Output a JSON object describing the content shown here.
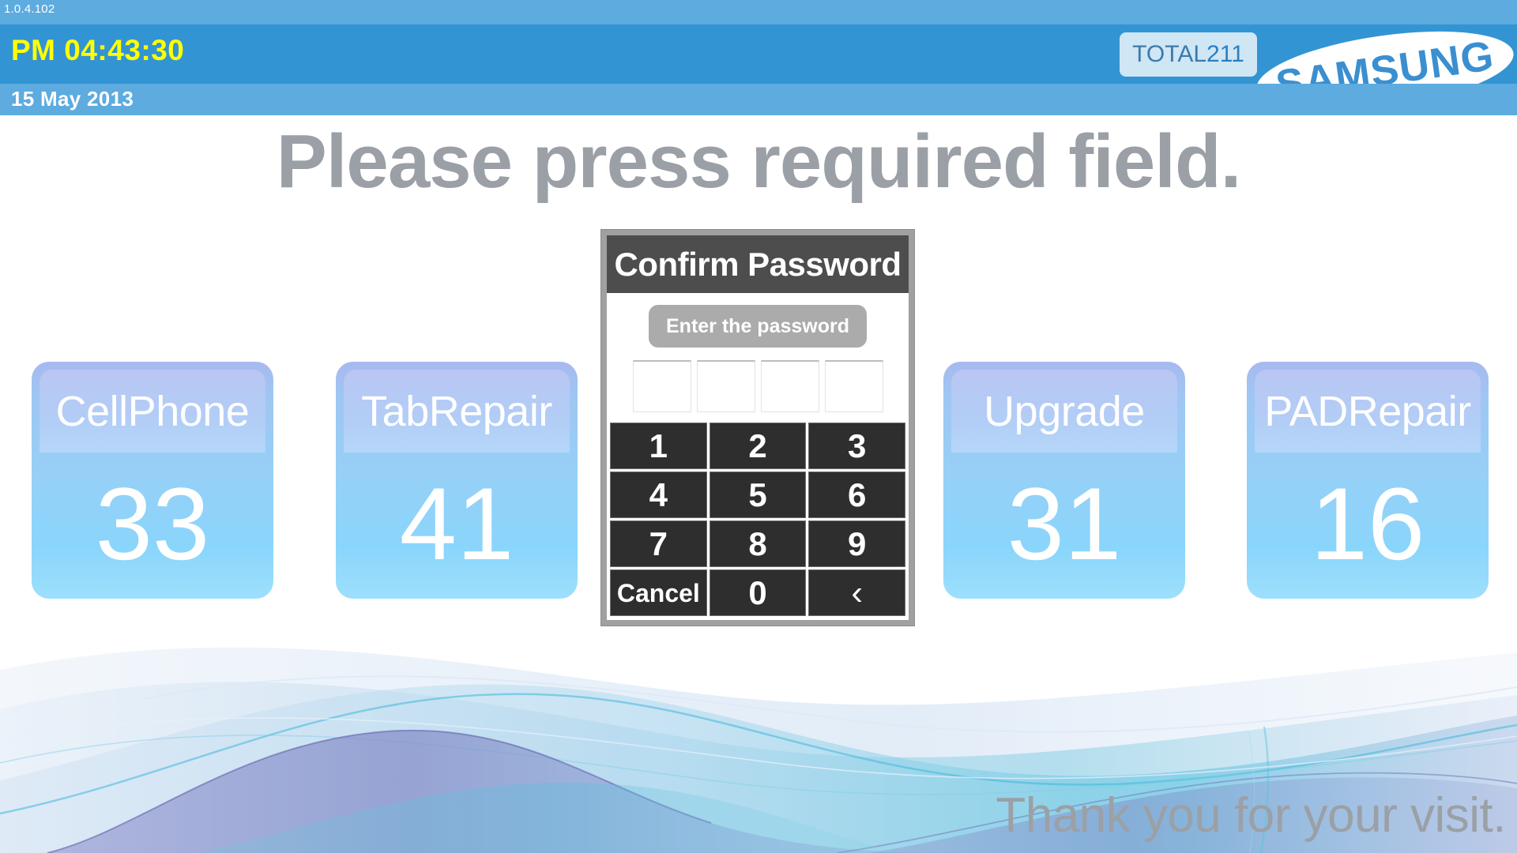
{
  "header": {
    "version": "1.0.4.102",
    "clock": "PM 04:43:30",
    "date": "15 May 2013",
    "total_label": "TOTAL",
    "total_value": "211",
    "brand": "SAMSUNG",
    "colors": {
      "band_light": "#5dabdf",
      "band_main": "#3394d3",
      "clock_text": "#ffff00",
      "badge_bg": "#cfe6f5",
      "badge_text": "#2a7fc4"
    }
  },
  "main": {
    "title": "Please press required field.",
    "title_color": "#9ba0a6",
    "tiles": [
      {
        "label": "CellPhone",
        "count": "33"
      },
      {
        "label": "TabRepair",
        "count": "41"
      },
      {
        "label": "Upgrade",
        "count": "31"
      },
      {
        "label": "PADRepair",
        "count": "16"
      }
    ]
  },
  "dialog": {
    "title": "Confirm Password",
    "hint": "Enter the password",
    "password_digits": [
      "",
      "",
      "",
      ""
    ],
    "keys": [
      {
        "label": "1",
        "name": "key-1",
        "kind": "digit"
      },
      {
        "label": "2",
        "name": "key-2",
        "kind": "digit"
      },
      {
        "label": "3",
        "name": "key-3",
        "kind": "digit"
      },
      {
        "label": "4",
        "name": "key-4",
        "kind": "digit"
      },
      {
        "label": "5",
        "name": "key-5",
        "kind": "digit"
      },
      {
        "label": "6",
        "name": "key-6",
        "kind": "digit"
      },
      {
        "label": "7",
        "name": "key-7",
        "kind": "digit"
      },
      {
        "label": "8",
        "name": "key-8",
        "kind": "digit"
      },
      {
        "label": "9",
        "name": "key-9",
        "kind": "digit"
      },
      {
        "label": "Cancel",
        "name": "key-cancel",
        "kind": "cancel"
      },
      {
        "label": "0",
        "name": "key-0",
        "kind": "digit"
      },
      {
        "label": "‹",
        "name": "key-backspace",
        "kind": "back"
      }
    ],
    "colors": {
      "frame": "#a0a0a0",
      "titlebar": "#4d4d4d",
      "hint_pill": "#ababab",
      "key_bg": "#2e2e2e"
    }
  },
  "footer": {
    "text": "Thank you for your visit.",
    "text_color": "#9ba0a6"
  }
}
